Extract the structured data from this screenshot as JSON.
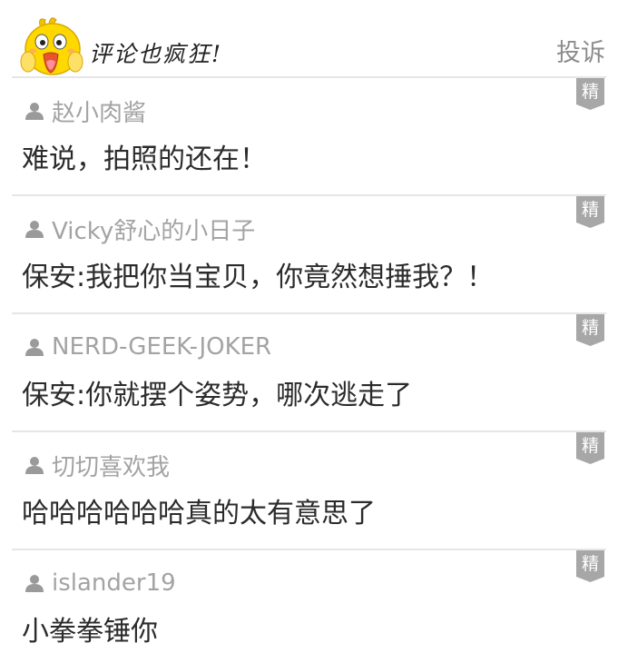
{
  "header": {
    "title": "评论也疯狂!",
    "report_label": "投诉"
  },
  "icons": {
    "mascot": "chick-mascot-icon",
    "user": "user-icon",
    "badge": "featured-badge"
  },
  "colors": {
    "badge": "#a7a7a7",
    "author": "#a3a3a3",
    "text": "#2b2b2b",
    "divider": "#e6e6e6",
    "report": "#8c8c8c"
  },
  "comments": [
    {
      "author": "赵小肉酱",
      "text": "难说，拍照的还在！",
      "badge": "精"
    },
    {
      "author": "Vicky舒心的小日子",
      "text": "保安:我把你当宝贝，你竟然想捶我？！",
      "badge": "精"
    },
    {
      "author": "NERD-GEEK-JOKER",
      "text": "保安:你就摆个姿势，哪次逃走了",
      "badge": "精"
    },
    {
      "author": "切切喜欢我",
      "text": "哈哈哈哈哈哈真的太有意思了",
      "badge": "精"
    },
    {
      "author": "islander19",
      "text": "小拳拳锤你",
      "badge": "精"
    }
  ]
}
